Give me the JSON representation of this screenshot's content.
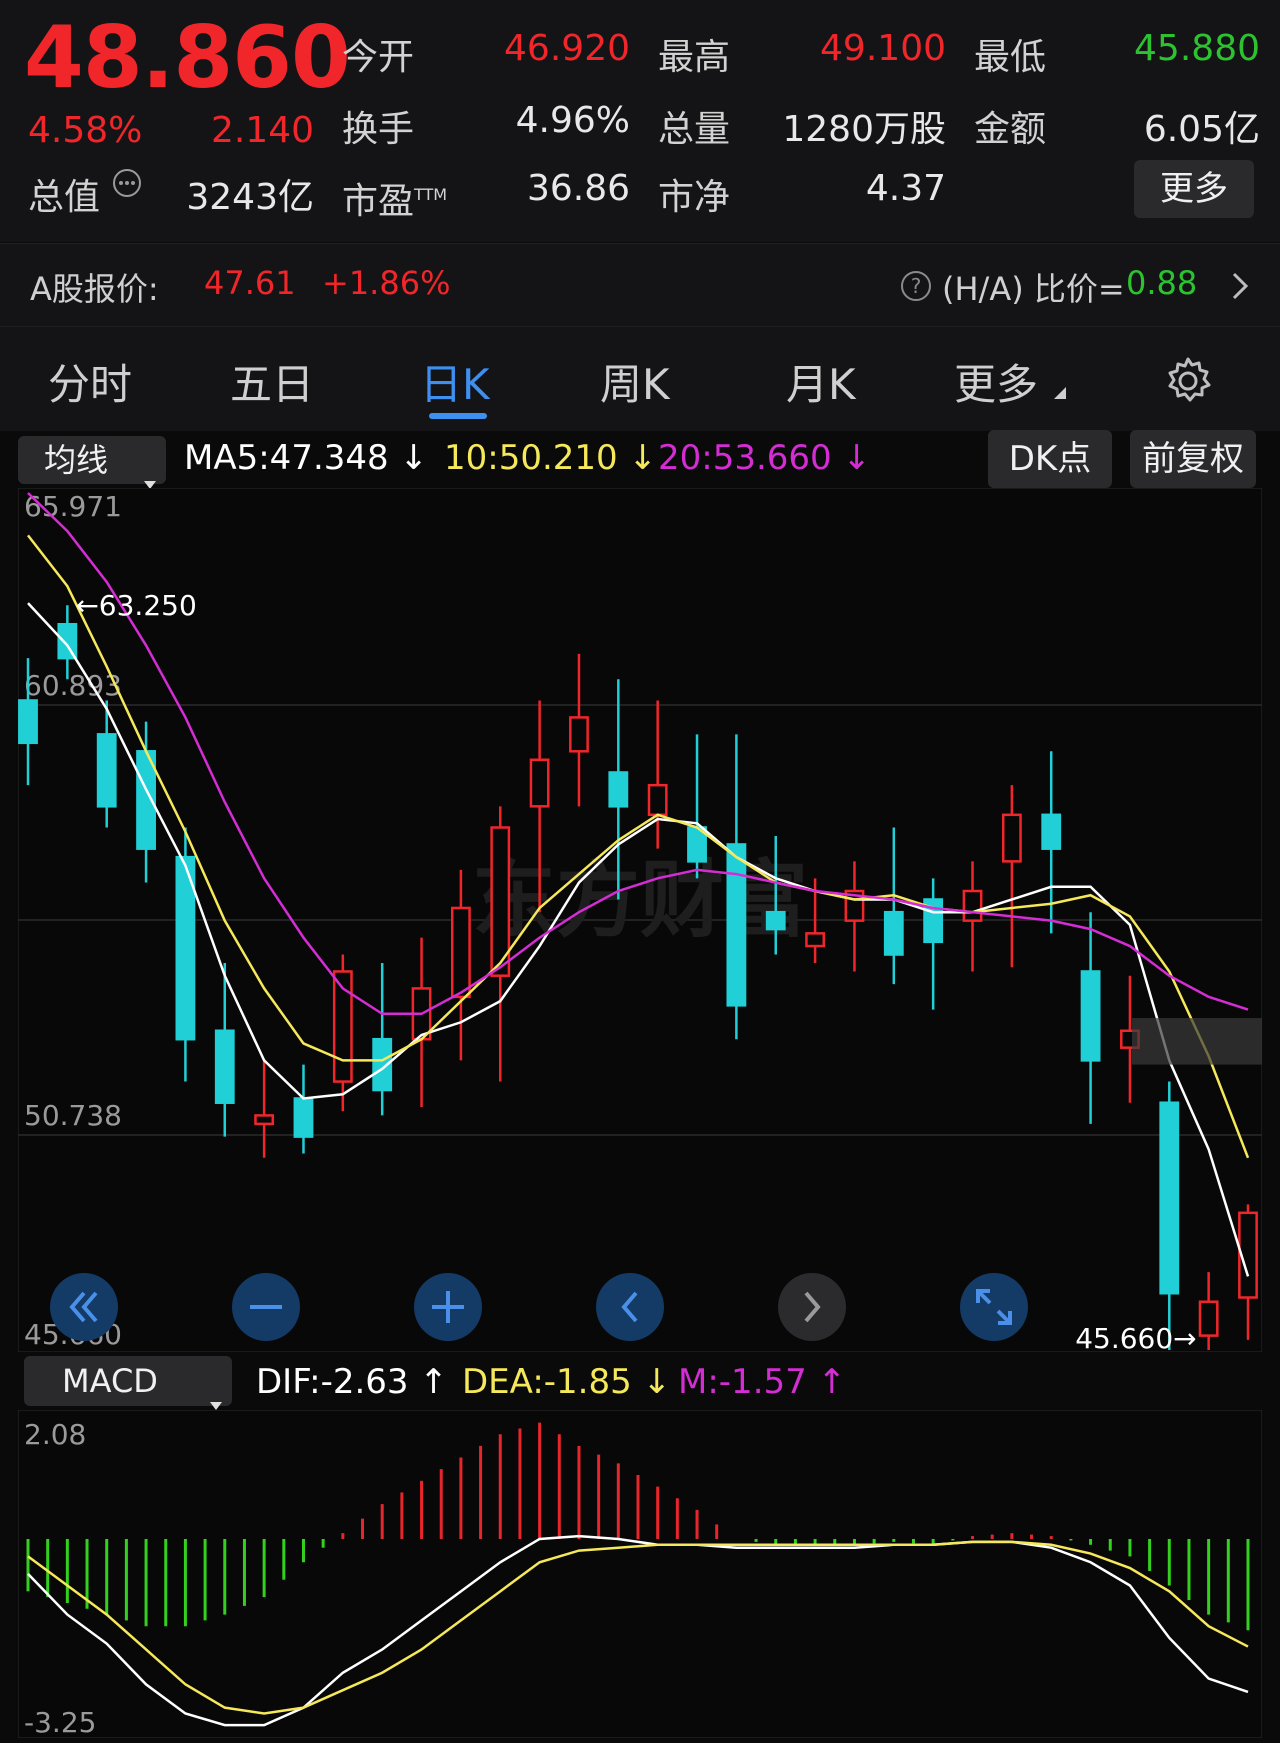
{
  "quote": {
    "price": "48.860",
    "change_pct": "4.58%",
    "change_abs": "2.140",
    "stats": [
      {
        "label": "今开",
        "value": "46.920",
        "color": "red"
      },
      {
        "label": "最高",
        "value": "49.100",
        "color": "red"
      },
      {
        "label": "最低",
        "value": "45.880",
        "color": "green"
      },
      {
        "label": "换手",
        "value": "4.96%",
        "color": "white"
      },
      {
        "label": "总量",
        "value": "1280万股",
        "color": "white"
      },
      {
        "label": "金额",
        "value": "6.05亿",
        "color": "white"
      },
      {
        "label": "市盈",
        "value": "36.86",
        "color": "white",
        "sup": "TTM"
      },
      {
        "label": "市净",
        "value": "4.37",
        "color": "white"
      }
    ],
    "market_cap_label": "总值",
    "market_cap_value": "3243亿",
    "more_button": "更多"
  },
  "a_share": {
    "label": "A股报价:",
    "price": "47.61",
    "change": "+1.86%",
    "ratio_label": "(H/A) 比价=",
    "ratio_value": "0.88"
  },
  "tabs": [
    "分时",
    "五日",
    "日K",
    "周K",
    "月K",
    "更多"
  ],
  "active_tab": "日K",
  "ma_bar": {
    "dropdown": "均线",
    "ma5": "MA5:47.348",
    "ma10": "10:50.210",
    "ma20": "20:53.660",
    "dk_button": "DK点",
    "adjust_button": "前复权"
  },
  "kline": {
    "labels": {
      "top": "65.971",
      "mid": "60.893",
      "low": "50.738",
      "bottom": "45.660"
    },
    "high_marker": "63.250",
    "low_marker": "45.660",
    "watermark": "东方财富"
  },
  "macd_bar": {
    "dropdown": "MACD",
    "dif": "DIF:-2.63",
    "dea": "DEA:-1.85",
    "m": "M:-1.57"
  },
  "macd": {
    "labels": {
      "top": "2.08",
      "bottom": "-3.25"
    }
  },
  "colors": {
    "up": "#f0262a",
    "down": "#21d0d6",
    "ma5": "#ffffff",
    "ma10": "#f5e85a",
    "ma20": "#d42dd4",
    "accent": "#3d8ff0",
    "macd_pos": "#e7262b",
    "macd_neg": "#33d11e"
  },
  "chart_data": [
    {
      "type": "candlestick",
      "title": "日K",
      "ylim": [
        45.66,
        65.971
      ],
      "series": [
        {
          "name": "MA5",
          "values": [
            63.3,
            62.3,
            60.8,
            58.9,
            57.1,
            54.5,
            52.5,
            51.6,
            51.7,
            52.3,
            53.1,
            53.4,
            53.9,
            55.2,
            56.7,
            57.6,
            58.2,
            58.1,
            57.3,
            56.8,
            56.5,
            56.3,
            56.3,
            56.0,
            56.0,
            56.3,
            56.6,
            56.6,
            55.7,
            52.5,
            50.4,
            47.4
          ]
        },
        {
          "name": "MA10",
          "values": [
            64.9,
            63.7,
            61.8,
            59.8,
            57.9,
            55.8,
            54.2,
            52.9,
            52.5,
            52.5,
            53.0,
            53.9,
            54.8,
            56.1,
            56.9,
            57.7,
            58.3,
            58.0,
            57.3,
            56.7,
            56.5,
            56.3,
            56.4,
            56.1,
            56.0,
            56.1,
            56.2,
            56.4,
            55.9,
            54.6,
            52.6,
            50.2
          ]
        },
        {
          "name": "MA20",
          "values": [
            65.9,
            65.0,
            63.8,
            62.3,
            60.6,
            58.6,
            56.8,
            55.4,
            54.2,
            53.6,
            53.6,
            54.1,
            54.7,
            55.4,
            56.0,
            56.5,
            56.8,
            57.0,
            56.9,
            56.7,
            56.5,
            56.4,
            56.3,
            56.1,
            56.0,
            55.9,
            55.8,
            55.6,
            55.2,
            54.5,
            54.0,
            53.7
          ]
        }
      ],
      "candles": [
        {
          "o": 61.0,
          "c": 60.0,
          "h": 62.0,
          "l": 59.0
        },
        {
          "o": 62.8,
          "c": 62.0,
          "h": 63.25,
          "l": 61.5
        },
        {
          "o": 60.2,
          "c": 58.5,
          "h": 61.0,
          "l": 58.0
        },
        {
          "o": 59.8,
          "c": 57.5,
          "h": 60.5,
          "l": 56.7
        },
        {
          "o": 57.3,
          "c": 53.0,
          "h": 58.0,
          "l": 52.0
        },
        {
          "o": 53.2,
          "c": 51.5,
          "h": 54.8,
          "l": 50.7
        },
        {
          "o": 51.0,
          "c": 51.2,
          "h": 52.5,
          "l": 50.2
        },
        {
          "o": 51.6,
          "c": 50.7,
          "h": 52.4,
          "l": 50.3
        },
        {
          "o": 52.0,
          "c": 54.6,
          "h": 55.0,
          "l": 51.3
        },
        {
          "o": 53.0,
          "c": 51.8,
          "h": 54.8,
          "l": 51.2
        },
        {
          "o": 53.0,
          "c": 54.2,
          "h": 55.4,
          "l": 51.4
        },
        {
          "o": 54.0,
          "c": 56.1,
          "h": 57.0,
          "l": 52.5
        },
        {
          "o": 54.5,
          "c": 58.0,
          "h": 58.5,
          "l": 52.0
        },
        {
          "o": 58.5,
          "c": 59.6,
          "h": 61.0,
          "l": 56.0
        },
        {
          "o": 59.8,
          "c": 60.6,
          "h": 62.1,
          "l": 58.5
        },
        {
          "o": 59.3,
          "c": 58.5,
          "h": 61.5,
          "l": 56.3
        },
        {
          "o": 58.3,
          "c": 59.0,
          "h": 61.0,
          "l": 57.5
        },
        {
          "o": 58.0,
          "c": 57.2,
          "h": 60.2,
          "l": 56.8
        },
        {
          "o": 57.6,
          "c": 53.8,
          "h": 60.2,
          "l": 53.0
        },
        {
          "o": 56.0,
          "c": 55.6,
          "h": 57.8,
          "l": 55.0
        },
        {
          "o": 55.2,
          "c": 55.5,
          "h": 56.8,
          "l": 54.8
        },
        {
          "o": 55.8,
          "c": 56.5,
          "h": 57.2,
          "l": 54.6
        },
        {
          "o": 56.0,
          "c": 55.0,
          "h": 58.0,
          "l": 54.3
        },
        {
          "o": 56.3,
          "c": 55.3,
          "h": 56.8,
          "l": 53.7
        },
        {
          "o": 55.8,
          "c": 56.5,
          "h": 57.2,
          "l": 54.6
        },
        {
          "o": 57.2,
          "c": 58.3,
          "h": 59.0,
          "l": 54.7
        },
        {
          "o": 58.3,
          "c": 57.5,
          "h": 59.8,
          "l": 55.5
        },
        {
          "o": 54.6,
          "c": 52.5,
          "h": 56.0,
          "l": 51.0
        },
        {
          "o": 52.8,
          "c": 53.2,
          "h": 54.5,
          "l": 51.5
        },
        {
          "o": 51.5,
          "c": 47.0,
          "h": 52.0,
          "l": 45.66
        },
        {
          "o": 46.0,
          "c": 46.8,
          "h": 47.5,
          "l": 45.66
        },
        {
          "o": 46.9,
          "c": 48.9,
          "h": 49.1,
          "l": 45.9
        }
      ]
    },
    {
      "type": "bar",
      "title": "MACD",
      "ylim": [
        -3.25,
        2.08
      ],
      "series": [
        {
          "name": "M",
          "values": [
            -0.9,
            -1.1,
            -1.3,
            -1.5,
            -1.5,
            -1.3,
            -1.0,
            -0.4,
            0.1,
            0.6,
            1.0,
            1.4,
            1.8,
            2.0,
            1.6,
            1.3,
            0.9,
            0.5,
            0.0,
            -0.1,
            -0.1,
            -0.1,
            -0.05,
            -0.1,
            0.05,
            0.1,
            0.05,
            -0.1,
            -0.3,
            -0.8,
            -1.3,
            -1.57
          ]
        },
        {
          "name": "DIF",
          "values": [
            -0.6,
            -1.3,
            -1.8,
            -2.5,
            -3.0,
            -3.2,
            -3.2,
            -2.9,
            -2.3,
            -1.9,
            -1.4,
            -0.9,
            -0.4,
            0.0,
            0.05,
            0.0,
            -0.1,
            -0.1,
            -0.15,
            -0.15,
            -0.15,
            -0.15,
            -0.1,
            -0.1,
            -0.05,
            -0.05,
            -0.15,
            -0.4,
            -0.8,
            -1.7,
            -2.4,
            -2.63
          ]
        },
        {
          "name": "DEA",
          "values": [
            -0.3,
            -0.8,
            -1.3,
            -1.9,
            -2.5,
            -2.9,
            -3.0,
            -2.9,
            -2.6,
            -2.3,
            -1.9,
            -1.4,
            -0.9,
            -0.4,
            -0.2,
            -0.15,
            -0.1,
            -0.1,
            -0.1,
            -0.1,
            -0.1,
            -0.1,
            -0.1,
            -0.1,
            -0.05,
            -0.05,
            -0.1,
            -0.25,
            -0.5,
            -0.9,
            -1.5,
            -1.85
          ]
        }
      ]
    }
  ]
}
